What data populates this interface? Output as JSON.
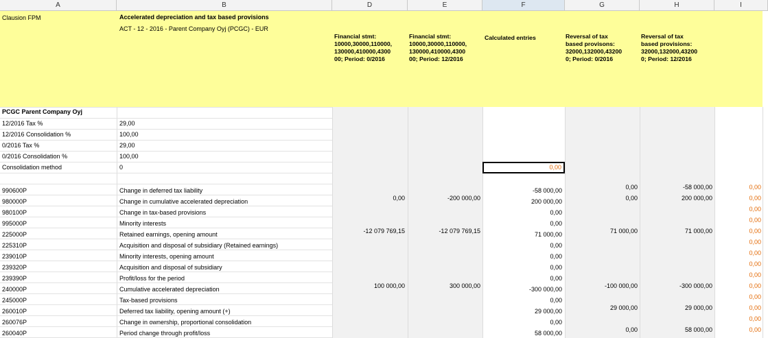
{
  "columns": [
    "A",
    "B",
    "D",
    "E",
    "F",
    "G",
    "H",
    "I"
  ],
  "selected_column": "F",
  "header": {
    "a_label": "Clausion FPM",
    "b_title": "Accelerated depreciation and tax based provisions",
    "b_subtitle": "ACT - 12 - 2016 - Parent Company Oyj (PCGC) - EUR",
    "col_d": [
      "Financial stmt:",
      "10000,30000,110000,",
      "130000,410000,4300",
      "00; Period: 0/2016"
    ],
    "col_e": [
      "Financial stmt:",
      "10000,30000,110000,",
      "130000,410000,4300",
      "00; Period: 12/2016"
    ],
    "col_f": [
      "Calculated entries"
    ],
    "col_g": [
      "Reversal of tax",
      "based provisons:",
      "32000,132000,43200",
      "0; Period: 0/2016"
    ],
    "col_h": [
      "Reversal of tax",
      "based provisions:",
      "32000,132000,43200",
      "0; Period:  12/2016"
    ]
  },
  "company": "PCGC Parent Company Oyj",
  "params": [
    {
      "label": "12/2016 Tax %",
      "value": "29,00"
    },
    {
      "label": "12/2016 Consolidation %",
      "value": "100,00"
    },
    {
      "label": "0/2016 Tax %",
      "value": "29,00"
    },
    {
      "label": "0/2016 Consolidation %",
      "value": "100,00"
    },
    {
      "label": "Consolidation method",
      "value": "0"
    }
  ],
  "active_cell_value": "0,00",
  "rows": [
    {
      "code": "990600P",
      "desc": "Change in deferred tax liability",
      "d": "",
      "e": "",
      "f": "-58 000,00",
      "g": "0,00",
      "h": "-58 000,00",
      "i": "0,00"
    },
    {
      "code": "980000P",
      "desc": "Change in cumulative accelerated depreciation",
      "d": "0,00",
      "e": "-200 000,00",
      "f": "200 000,00",
      "g": "0,00",
      "h": "200 000,00",
      "i": "0,00"
    },
    {
      "code": "980100P",
      "desc": "Change in tax-based provisions",
      "d": "",
      "e": "",
      "f": "0,00",
      "g": "",
      "h": "",
      "i": "0,00"
    },
    {
      "code": "995000P",
      "desc": "Minority interests",
      "d": "",
      "e": "",
      "f": "0,00",
      "g": "",
      "h": "",
      "i": "0,00"
    },
    {
      "code": "225000P",
      "desc": "Retained earnings, opening amount",
      "d": "-12 079 769,15",
      "e": "-12 079 769,15",
      "f": "71 000,00",
      "g": "71 000,00",
      "h": "71 000,00",
      "i": "0,00"
    },
    {
      "code": "225310P",
      "desc": "Acquisition and disposal of subsidiary (Retained earnings)",
      "d": "",
      "e": "",
      "f": "0,00",
      "g": "",
      "h": "",
      "i": "0,00"
    },
    {
      "code": "239010P",
      "desc": "Minority interests, opening amount",
      "d": "",
      "e": "",
      "f": "0,00",
      "g": "",
      "h": "",
      "i": "0,00"
    },
    {
      "code": "239320P",
      "desc": "Acquisition and disposal of subsidiary",
      "d": "",
      "e": "",
      "f": "0,00",
      "g": "",
      "h": "",
      "i": "0,00"
    },
    {
      "code": "239390P",
      "desc": "Profit/loss for the period",
      "d": "",
      "e": "",
      "f": "0,00",
      "g": "",
      "h": "",
      "i": "0,00"
    },
    {
      "code": "240000P",
      "desc": "Cumulative accelerated depreciation",
      "d": "100 000,00",
      "e": "300 000,00",
      "f": "-300 000,00",
      "g": "-100 000,00",
      "h": "-300 000,00",
      "i": "0,00"
    },
    {
      "code": "245000P",
      "desc": "Tax-based provisions",
      "d": "",
      "e": "",
      "f": "0,00",
      "g": "",
      "h": "",
      "i": "0,00"
    },
    {
      "code": "260010P",
      "desc": "Deferred tax liability, opening amount (+)",
      "d": "",
      "e": "",
      "f": "29 000,00",
      "g": "29 000,00",
      "h": "29 000,00",
      "i": "0,00"
    },
    {
      "code": "260076P",
      "desc": "Change in ownership, proportional consolidation",
      "d": "",
      "e": "",
      "f": "0,00",
      "g": "",
      "h": "",
      "i": "0,00"
    },
    {
      "code": "260040P",
      "desc": "Period change through profit/loss",
      "d": "",
      "e": "",
      "f": "58 000,00",
      "g": "0,00",
      "h": "58 000,00",
      "i": "0,00"
    }
  ]
}
